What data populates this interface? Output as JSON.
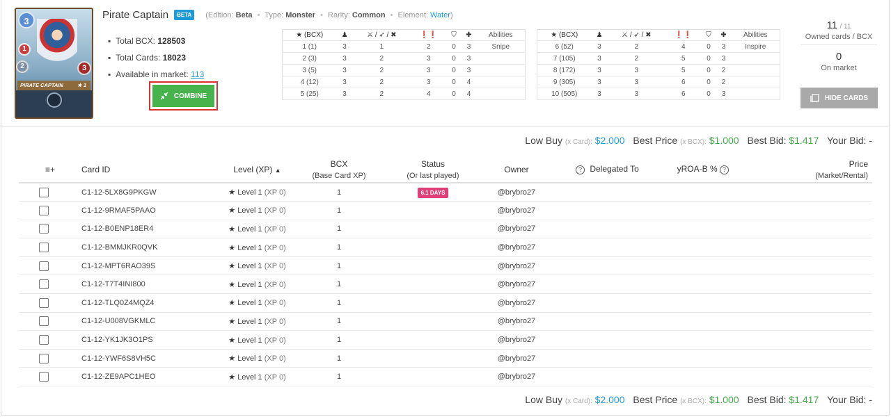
{
  "card": {
    "name": "Pirate Captain",
    "edition_badge": "BETA",
    "meta": {
      "edition_label": "(Edition:",
      "edition": "Beta",
      "type_label": "Type:",
      "type": "Monster",
      "rarity_label": "Rarity:",
      "rarity": "Common",
      "element_label": "Element:",
      "element": "Water",
      "close": ")"
    },
    "image": {
      "mana": "3",
      "speed": "1",
      "armor": "2",
      "health": "3",
      "banner": "PIRATE CAPTAIN",
      "level_mark": "★ 1"
    }
  },
  "stats": {
    "total_bcx_label": "Total BCX:",
    "total_bcx": "128503",
    "total_cards_label": "Total Cards:",
    "total_cards": "18023",
    "available_label": "Available in market:",
    "available": "113"
  },
  "combine_label": "COMBINE",
  "level_table_headers": [
    "★ (BCX)",
    "♟",
    "⚔ / ➶ / ✖",
    "❗❗",
    "⛉",
    "✚",
    "Abilities"
  ],
  "level_table_left": [
    [
      "1 (1)",
      "3",
      "1",
      "2",
      "0",
      "3",
      "Snipe"
    ],
    [
      "2 (3)",
      "3",
      "2",
      "3",
      "0",
      "3",
      ""
    ],
    [
      "3 (5)",
      "3",
      "2",
      "3",
      "0",
      "3",
      ""
    ],
    [
      "4 (12)",
      "3",
      "2",
      "3",
      "0",
      "4",
      ""
    ],
    [
      "5 (25)",
      "3",
      "2",
      "4",
      "0",
      "4",
      ""
    ]
  ],
  "level_table_right": [
    [
      "6 (52)",
      "3",
      "2",
      "4",
      "0",
      "3",
      "Inspire"
    ],
    [
      "7 (105)",
      "3",
      "2",
      "5",
      "0",
      "3",
      ""
    ],
    [
      "8 (172)",
      "3",
      "3",
      "5",
      "0",
      "2",
      ""
    ],
    [
      "9 (305)",
      "3",
      "3",
      "6",
      "0",
      "2",
      ""
    ],
    [
      "10 (505)",
      "3",
      "3",
      "6",
      "0",
      "3",
      ""
    ]
  ],
  "owned": {
    "count": "11",
    "total": "/ 11",
    "label": "Owned cards / BCX",
    "market_count": "0",
    "market_label": "On market"
  },
  "hide_cards_label": "HIDE CARDS",
  "price_bar": {
    "low_buy_label": "Low Buy",
    "low_buy_unit": "(x Card):",
    "low_buy": "$2.000",
    "best_price_label": "Best Price",
    "best_price_unit": "(x BCX):",
    "best_price": "$1.000",
    "best_bid_label": "Best Bid:",
    "best_bid": "$1.417",
    "your_bid_label": "Your Bid:",
    "your_bid": "-"
  },
  "table_headers": {
    "select_icon": "≡+",
    "card_id": "Card ID",
    "level": "Level (XP)",
    "level_sort": "▲",
    "bcx": "BCX",
    "bcx_sub": "(Base Card XP)",
    "status": "Status",
    "status_sub": "(Or last played)",
    "owner": "Owner",
    "delegated": "Delegated To",
    "yroa": "yROA-B %",
    "price": "Price",
    "price_sub": "(Market/Rental)"
  },
  "rows": [
    {
      "id": "C1-12-5LX8G9PKGW",
      "level": "Level 1",
      "xp": "(XP 0)",
      "bcx": "1",
      "status": "6.1 DAYS",
      "owner": "@brybro27"
    },
    {
      "id": "C1-12-9RMAF5PAAO",
      "level": "Level 1",
      "xp": "(XP 0)",
      "bcx": "1",
      "status": "",
      "owner": "@brybro27"
    },
    {
      "id": "C1-12-B0ENP18ER4",
      "level": "Level 1",
      "xp": "(XP 0)",
      "bcx": "1",
      "status": "",
      "owner": "@brybro27"
    },
    {
      "id": "C1-12-BMMJKR0QVK",
      "level": "Level 1",
      "xp": "(XP 0)",
      "bcx": "1",
      "status": "",
      "owner": "@brybro27"
    },
    {
      "id": "C1-12-MPT6RAO39S",
      "level": "Level 1",
      "xp": "(XP 0)",
      "bcx": "1",
      "status": "",
      "owner": "@brybro27"
    },
    {
      "id": "C1-12-T7T4INI800",
      "level": "Level 1",
      "xp": "(XP 0)",
      "bcx": "1",
      "status": "",
      "owner": "@brybro27"
    },
    {
      "id": "C1-12-TLQ0Z4MQZ4",
      "level": "Level 1",
      "xp": "(XP 0)",
      "bcx": "1",
      "status": "",
      "owner": "@brybro27"
    },
    {
      "id": "C1-12-U008VGKMLC",
      "level": "Level 1",
      "xp": "(XP 0)",
      "bcx": "1",
      "status": "",
      "owner": "@brybro27"
    },
    {
      "id": "C1-12-YK1JK3O1PS",
      "level": "Level 1",
      "xp": "(XP 0)",
      "bcx": "1",
      "status": "",
      "owner": "@brybro27"
    },
    {
      "id": "C1-12-YWF6S8VH5C",
      "level": "Level 1",
      "xp": "(XP 0)",
      "bcx": "1",
      "status": "",
      "owner": "@brybro27"
    },
    {
      "id": "C1-12-ZE9APC1HEO",
      "level": "Level 1",
      "xp": "(XP 0)",
      "bcx": "1",
      "status": "",
      "owner": "@brybro27"
    }
  ],
  "colors": {
    "accent_blue": "#1e9ad6",
    "combine_green": "#46b34c",
    "highlight_red": "#d93030",
    "price_green": "#46a54c",
    "status_pink": "#e0407a"
  }
}
